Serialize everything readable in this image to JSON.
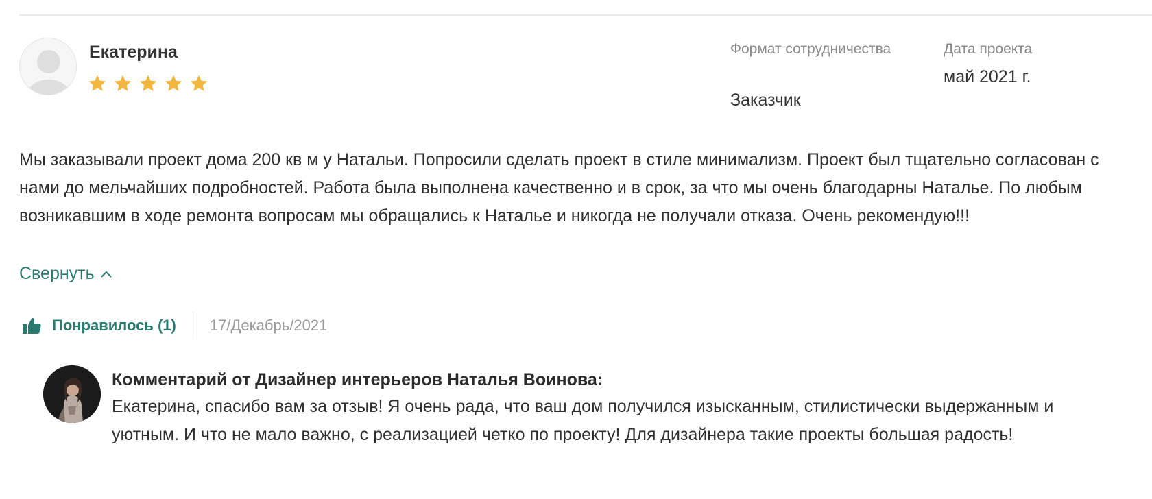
{
  "review": {
    "author": "Екатерина",
    "rating": 5,
    "rating_max": 5,
    "format_label": "Формат сотрудничества",
    "format_value": "Заказчик",
    "date_label": "Дата проекта",
    "date_value": "май 2021 г.",
    "text": "Мы заказывали проект дома 200 кв м у Натальи. Попросили сделать проект в стиле минимализм. Проект был тщательно согласован с нами до мельчайших подробностей. Работа была выполнена качественно и в срок, за что мы очень благодарны Наталье. По любым возникавшим в ходе ремонта вопросам мы обращались к Наталье и никогда не получали отказа. Очень рекомендую!!!",
    "collapse_label": "Свернуть",
    "like_label": "Понравилось (1)",
    "posted_date": "17/Декабрь/2021"
  },
  "comment": {
    "author_label": "Комментарий от Дизайнер интерьеров Наталья Воинова:",
    "text": "Екатерина, спасибо вам за отзыв! Я очень рада, что ваш дом получился изысканным, стилистически выдержанным и уютным. И что не мало важно, с реализацией четко по проекту! Для дизайнера такие проекты большая радость!"
  },
  "icons": {
    "avatar": "user-silhouette-icon",
    "star": "star-icon",
    "collapse": "chevron-up-icon",
    "like": "thumbs-up-icon"
  },
  "colors": {
    "accent": "#2a7a6f",
    "star": "#f0b63f",
    "muted": "#8a8a8a"
  }
}
